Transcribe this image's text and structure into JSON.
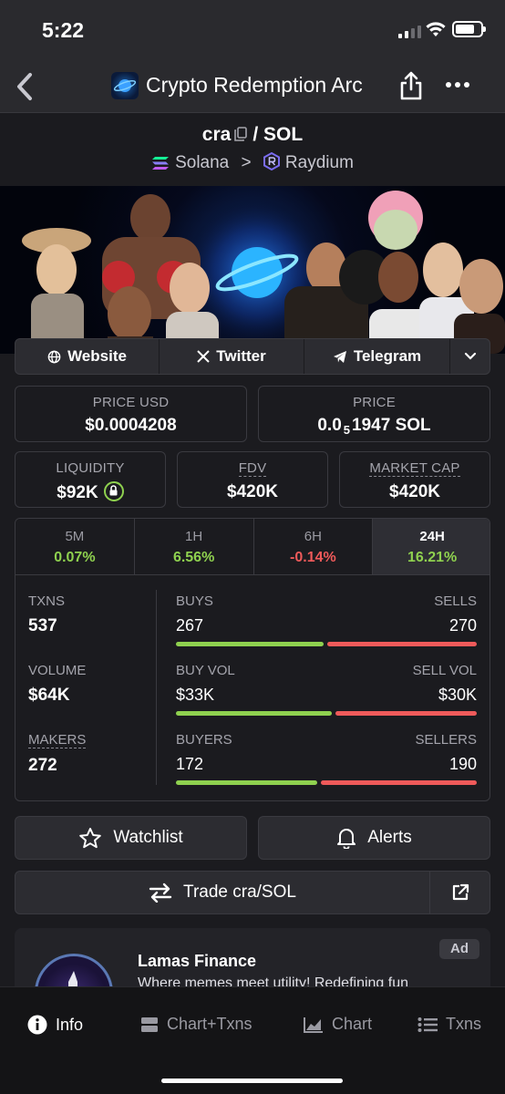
{
  "status_bar": {
    "time": "5:22"
  },
  "header": {
    "title": "Crypto Redemption Arc"
  },
  "pair": {
    "base": "cra",
    "separator": "/",
    "quote": "SOL",
    "chain": "Solana",
    "chevron": ">",
    "dex": "Raydium"
  },
  "links": {
    "website": "Website",
    "twitter": "Twitter",
    "telegram": "Telegram"
  },
  "price_usd": {
    "label": "PRICE USD",
    "value": "$0.0004208"
  },
  "price_native": {
    "label": "PRICE",
    "prefix": "0.0",
    "zeros": "5",
    "digits": "1947",
    "unit": "SOL"
  },
  "liquidity": {
    "label": "LIQUIDITY",
    "value": "$92K"
  },
  "fdv": {
    "label": "FDV",
    "value": "$420K"
  },
  "market_cap": {
    "label": "MARKET CAP",
    "value": "$420K"
  },
  "timeframes": [
    {
      "label": "5M",
      "value": "0.07%"
    },
    {
      "label": "1H",
      "value": "6.56%"
    },
    {
      "label": "6H",
      "value": "-0.14%"
    },
    {
      "label": "24H",
      "value": "16.21%"
    }
  ],
  "stats": {
    "txns": {
      "label": "TXNS",
      "value": "537"
    },
    "volume": {
      "label": "VOLUME",
      "value": "$64K"
    },
    "makers": {
      "label": "MAKERS",
      "value": "272"
    },
    "buys": {
      "label": "BUYS",
      "value": "267",
      "ratio": 0.497
    },
    "sells": {
      "label": "SELLS",
      "value": "270"
    },
    "buy_vol": {
      "label": "BUY VOL",
      "value": "$33K",
      "ratio": 0.524
    },
    "sell_vol": {
      "label": "SELL VOL",
      "value": "$30K"
    },
    "buyers": {
      "label": "BUYERS",
      "value": "172",
      "ratio": 0.475
    },
    "sellers": {
      "label": "SELLERS",
      "value": "190"
    }
  },
  "actions": {
    "watchlist": "Watchlist",
    "alerts": "Alerts",
    "trade": "Trade cra/SOL"
  },
  "ad": {
    "name": "Lamas Finance",
    "description": "Where memes meet utility! Redefining fun",
    "badge": "Ad"
  },
  "tabbar": {
    "info": "Info",
    "chart_txns": "Chart+Txns",
    "chart": "Chart",
    "txns": "Txns"
  },
  "colors": {
    "positive": "#8fd14f",
    "negative": "#ef5a5a",
    "background": "#1b1b1f"
  }
}
